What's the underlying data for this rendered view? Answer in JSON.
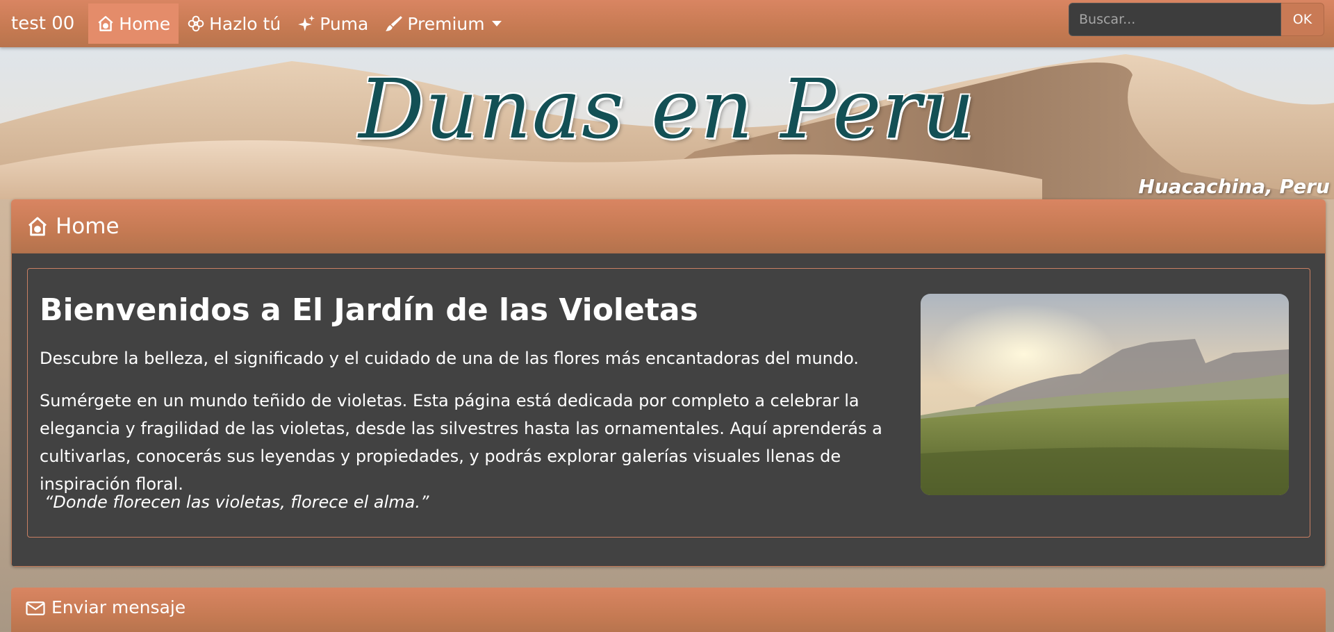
{
  "navbar": {
    "brand": "test 00",
    "items": [
      {
        "label": "Home",
        "icon": "home-icon",
        "active": true
      },
      {
        "label": "Hazlo tú",
        "icon": "flower-icon",
        "active": false
      },
      {
        "label": "Puma",
        "icon": "sparkles-icon",
        "active": false
      },
      {
        "label": "Premium",
        "icon": "brush-icon",
        "active": false,
        "dropdown": true
      }
    ],
    "search": {
      "placeholder": "Buscar...",
      "button": "OK"
    }
  },
  "banner": {
    "title": "Dunas en Peru",
    "caption": "Huacachina, Peru"
  },
  "home_panel": {
    "header": "Home",
    "title": "Bienvenidos a El Jardín de las Violetas",
    "paragraph1": "Descubre la belleza, el significado y el cuidado de una de las flores más encantadoras del mundo.",
    "paragraph2": "Sumérgete en un mundo teñido de violetas. Esta página está dedicada por completo a celebrar la elegancia y fragilidad de las violetas, desde las silvestres hasta las ornamentales. Aquí aprenderás a cultivarlas, conocerás sus leyendas y propiedades, y podrás explorar galerías visuales llenas de inspiración floral.",
    "quote": "“Donde florecen las violetas, florece el alma.”"
  },
  "message_panel": {
    "header": "Enviar mensaje",
    "icon": "envelope-icon"
  },
  "colors": {
    "accent": "#d98562",
    "panel_body": "#424242",
    "title_teal": "#135055"
  }
}
